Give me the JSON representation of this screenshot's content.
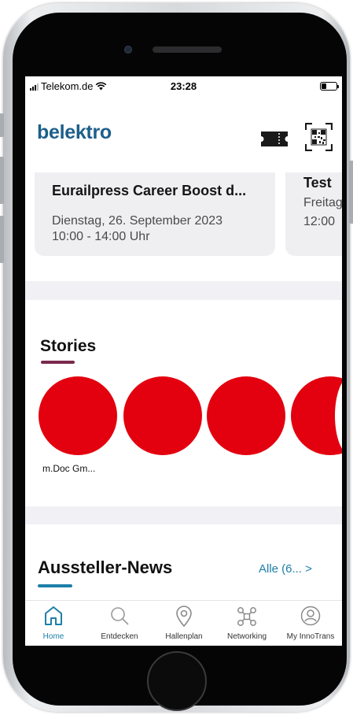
{
  "status_bar": {
    "carrier": "Telekom.de",
    "time": "23:28"
  },
  "header": {
    "logo": "belektro",
    "ticket_icon": "ticket-icon",
    "qr_icon": "qr-code-icon"
  },
  "events": [
    {
      "title": "Eurailpress Career Boost d...",
      "date": "Dienstag, 26. September 2023",
      "time": "10:00 - 14:00 Uhr"
    },
    {
      "title": "Test",
      "date": "Freitag",
      "time": "12:00"
    }
  ],
  "stories": {
    "title": "Stories",
    "items": [
      {
        "label": "m.Doc Gm..."
      },
      {
        "label": ""
      },
      {
        "label": ""
      },
      {
        "label": ""
      }
    ]
  },
  "news": {
    "title": "Aussteller-News",
    "all_link": "Alle (6... >"
  },
  "tab_bar": {
    "items": [
      {
        "label": "Home",
        "icon": "home-icon",
        "active": true
      },
      {
        "label": "Entdecken",
        "icon": "search-icon",
        "active": false
      },
      {
        "label": "Hallenplan",
        "icon": "map-pin-icon",
        "active": false
      },
      {
        "label": "Networking",
        "icon": "network-icon",
        "active": false
      },
      {
        "label": "My InnoTrans",
        "icon": "user-icon",
        "active": false
      }
    ]
  },
  "colors": {
    "brand_blue": "#1d7fa8",
    "logo_blue": "#1d5f8a",
    "story_red": "#e3000f",
    "stories_accent": "#7b2a4e"
  }
}
